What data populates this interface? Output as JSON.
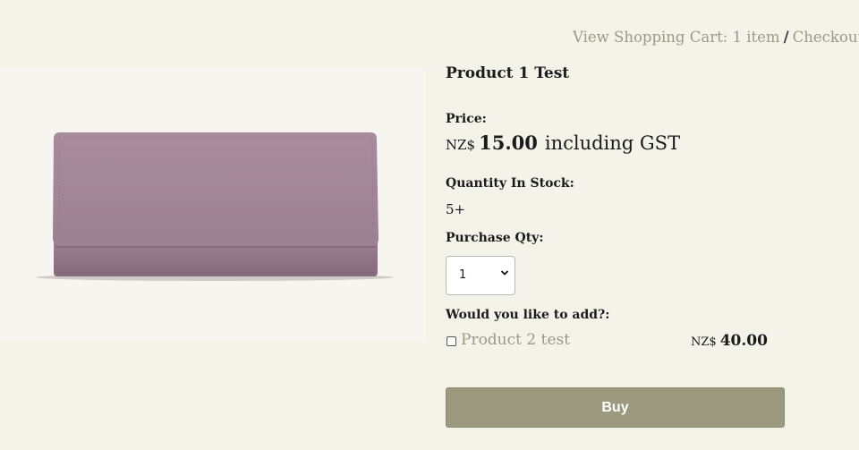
{
  "header": {
    "cart_link": "View Shopping Cart: 1 item",
    "separator": "/",
    "checkout_link": "Checkout"
  },
  "product": {
    "image_icon": "purse-image",
    "title": "Product 1 Test",
    "price_label": "Price:",
    "currency": "NZ$",
    "price": "15.00",
    "tax_note": "including GST",
    "stock_label": "Quantity In Stock:",
    "stock_value": "5+",
    "qty_label": "Purchase Qty:",
    "qty_selected": "1"
  },
  "addons": {
    "label": "Would you like to add?:",
    "items": [
      {
        "name": "Product 2 test",
        "currency": "NZ$",
        "price": "40.00",
        "checked": false
      }
    ]
  },
  "actions": {
    "buy_label": "Buy"
  },
  "colors": {
    "background": "#f4f3e9",
    "accent": "#9b9a7e",
    "link": "#9a9a86"
  }
}
